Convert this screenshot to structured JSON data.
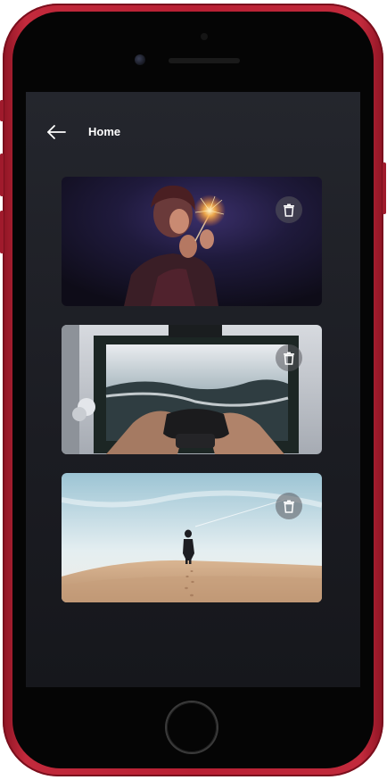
{
  "device": {
    "frame_color": "#b81f33"
  },
  "header": {
    "back_icon": "arrow-left-icon",
    "title": "Home"
  },
  "cards": [
    {
      "photo": "person-holding-sparkler",
      "action_icon": "trash-icon"
    },
    {
      "photo": "hands-holding-game-controller",
      "action_icon": "trash-icon"
    },
    {
      "photo": "person-walking-on-desert-dune",
      "action_icon": "trash-icon"
    }
  ],
  "colors": {
    "screen_background": "#1f2026",
    "title_text": "#ffffff"
  }
}
